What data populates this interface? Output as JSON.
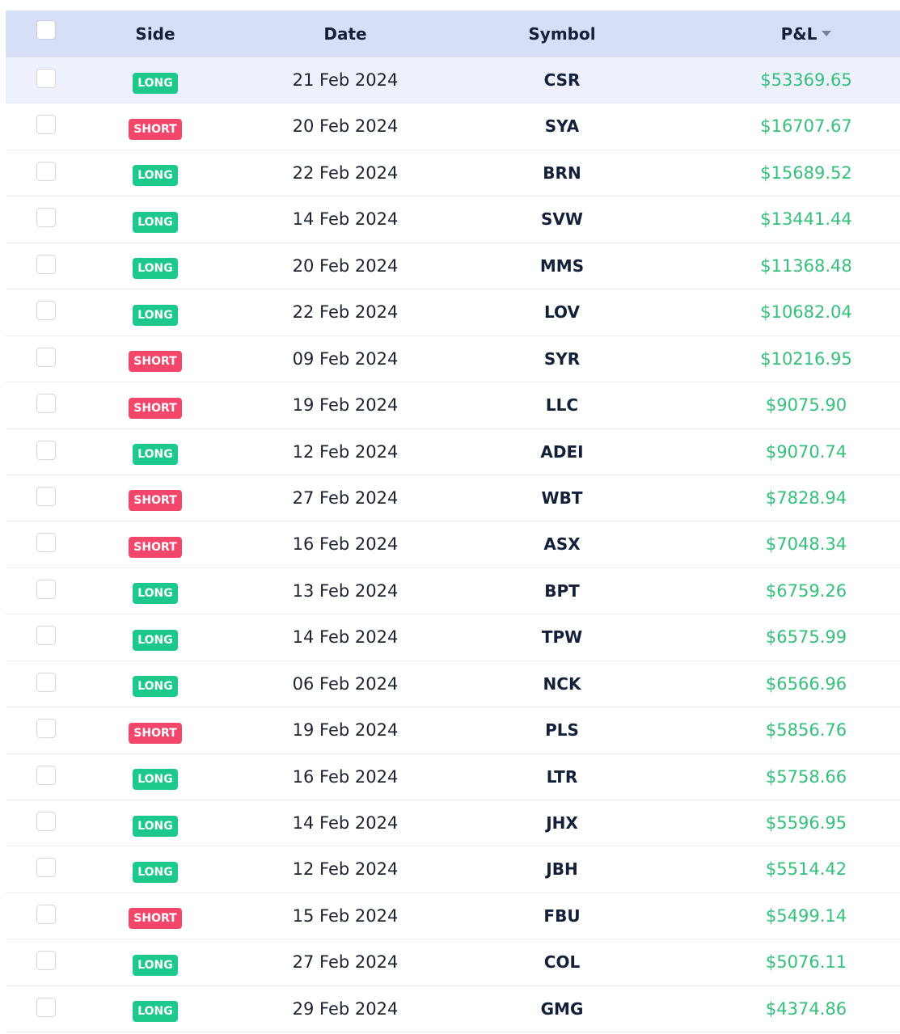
{
  "header": {
    "side": "Side",
    "date": "Date",
    "symbol": "Symbol",
    "pnl": "P&L"
  },
  "colors": {
    "header_bg": "#d7dff7",
    "long": "#1cc98b",
    "short": "#f2476a",
    "profit": "#34c07b",
    "highlight_row": "#eef1fb"
  },
  "rows": [
    {
      "side": "LONG",
      "date": "21 Feb 2024",
      "symbol": "CSR",
      "pnl": "$53369.65"
    },
    {
      "side": "SHORT",
      "date": "20 Feb 2024",
      "symbol": "SYA",
      "pnl": "$16707.67"
    },
    {
      "side": "LONG",
      "date": "22 Feb 2024",
      "symbol": "BRN",
      "pnl": "$15689.52"
    },
    {
      "side": "LONG",
      "date": "14 Feb 2024",
      "symbol": "SVW",
      "pnl": "$13441.44"
    },
    {
      "side": "LONG",
      "date": "20 Feb 2024",
      "symbol": "MMS",
      "pnl": "$11368.48"
    },
    {
      "side": "LONG",
      "date": "22 Feb 2024",
      "symbol": "LOV",
      "pnl": "$10682.04"
    },
    {
      "side": "SHORT",
      "date": "09 Feb 2024",
      "symbol": "SYR",
      "pnl": "$10216.95"
    },
    {
      "side": "SHORT",
      "date": "19 Feb 2024",
      "symbol": "LLC",
      "pnl": "$9075.90"
    },
    {
      "side": "LONG",
      "date": "12 Feb 2024",
      "symbol": "ADEI",
      "pnl": "$9070.74"
    },
    {
      "side": "SHORT",
      "date": "27 Feb 2024",
      "symbol": "WBT",
      "pnl": "$7828.94"
    },
    {
      "side": "SHORT",
      "date": "16 Feb 2024",
      "symbol": "ASX",
      "pnl": "$7048.34"
    },
    {
      "side": "LONG",
      "date": "13 Feb 2024",
      "symbol": "BPT",
      "pnl": "$6759.26"
    },
    {
      "side": "LONG",
      "date": "14 Feb 2024",
      "symbol": "TPW",
      "pnl": "$6575.99"
    },
    {
      "side": "LONG",
      "date": "06 Feb 2024",
      "symbol": "NCK",
      "pnl": "$6566.96"
    },
    {
      "side": "SHORT",
      "date": "19 Feb 2024",
      "symbol": "PLS",
      "pnl": "$5856.76"
    },
    {
      "side": "LONG",
      "date": "16 Feb 2024",
      "symbol": "LTR",
      "pnl": "$5758.66"
    },
    {
      "side": "LONG",
      "date": "14 Feb 2024",
      "symbol": "JHX",
      "pnl": "$5596.95"
    },
    {
      "side": "LONG",
      "date": "12 Feb 2024",
      "symbol": "JBH",
      "pnl": "$5514.42"
    },
    {
      "side": "SHORT",
      "date": "15 Feb 2024",
      "symbol": "FBU",
      "pnl": "$5499.14"
    },
    {
      "side": "LONG",
      "date": "27 Feb 2024",
      "symbol": "COL",
      "pnl": "$5076.11"
    },
    {
      "side": "LONG",
      "date": "29 Feb 2024",
      "symbol": "GMG",
      "pnl": "$4374.86"
    }
  ]
}
